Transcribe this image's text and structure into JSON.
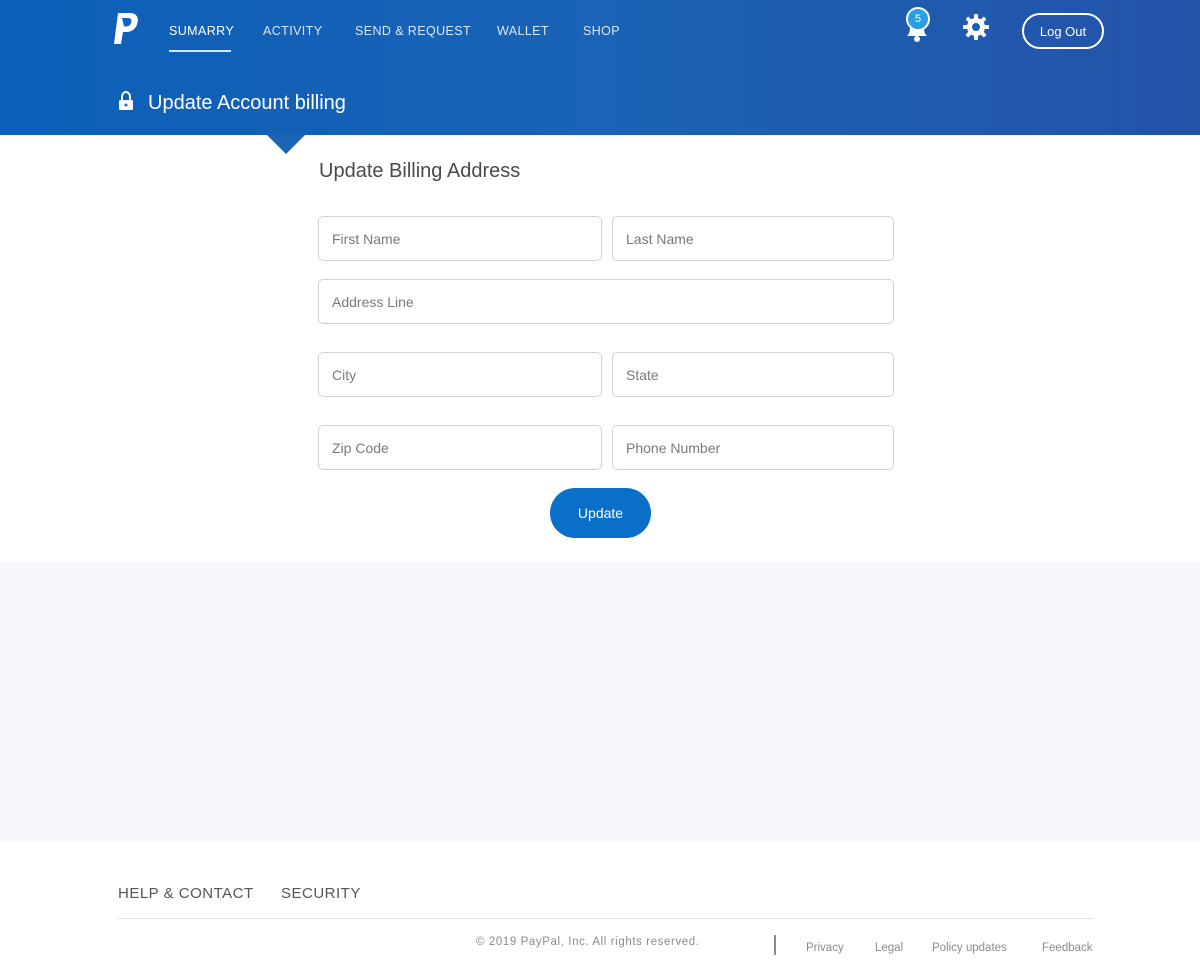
{
  "header": {
    "logo": "paypal-logo",
    "nav": [
      {
        "label": "SUMARRY",
        "active": true
      },
      {
        "label": "ACTIVITY",
        "active": false
      },
      {
        "label": "SEND & REQUEST",
        "active": false
      },
      {
        "label": "WALLET",
        "active": false
      },
      {
        "label": "SHOP",
        "active": false
      }
    ],
    "notification_count": "5",
    "logout_label": "Log Out",
    "page_heading": "Update Account billing"
  },
  "form": {
    "title": "Update Billing Address",
    "fields": {
      "first_name": {
        "placeholder": "First Name",
        "value": ""
      },
      "last_name": {
        "placeholder": "Last Name",
        "value": ""
      },
      "address": {
        "placeholder": "Address Line",
        "value": ""
      },
      "city": {
        "placeholder": "City",
        "value": ""
      },
      "state": {
        "placeholder": "State",
        "value": ""
      },
      "zip": {
        "placeholder": "Zip Code",
        "value": ""
      },
      "phone": {
        "placeholder": "Phone Number",
        "value": ""
      }
    },
    "submit_label": "Update"
  },
  "footer": {
    "links": [
      "HELP & CONTACT",
      "SECURITY"
    ],
    "copyright": "© 2019 PayPal, Inc. All rights reserved.",
    "legal_links": [
      "Privacy",
      "Legal",
      "Policy updates",
      "Feedback"
    ]
  },
  "colors": {
    "header_blue": "#1b63b5",
    "button_blue": "#0a6fc8",
    "badge_blue": "#2a9fe3",
    "footer_band": "#f5f7fa"
  },
  "icons": [
    "paypal-logo",
    "bell-icon",
    "gear-icon",
    "lock-icon"
  ]
}
